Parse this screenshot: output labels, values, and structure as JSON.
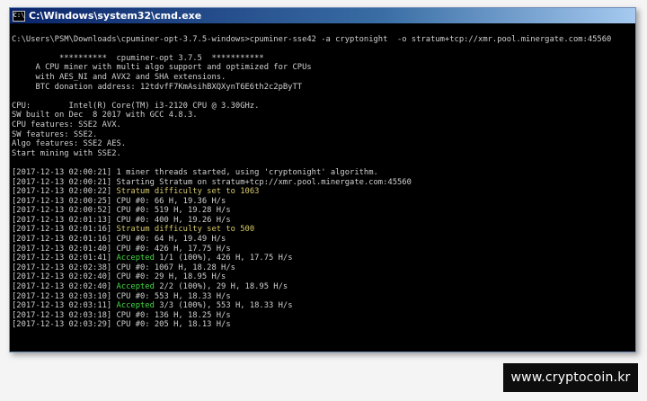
{
  "window": {
    "title": "C:\\Windows\\system32\\cmd.exe",
    "icon": "cmd-icon"
  },
  "console": {
    "lines": [
      {
        "text": ""
      },
      {
        "text": "C:\\Users\\PSM\\Downloads\\cpuminer-opt-3.7.5-windows>cpuminer-sse42 -a cryptonight  -o stratum+tcp://xmr.pool.minergate.com:45560"
      },
      {
        "text": ""
      },
      {
        "text": "          **********  cpuminer-opt 3.7.5  ***********"
      },
      {
        "text": "     A CPU miner with multi algo support and optimized for CPUs"
      },
      {
        "text": "     with AES_NI and AVX2 and SHA extensions."
      },
      {
        "text": "     BTC donation address: 12tdvfF7KmAsihBXQXynT6E6th2c2pByTT"
      },
      {
        "text": ""
      },
      {
        "text": "CPU:        Intel(R) Core(TM) i3-2120 CPU @ 3.30GHz."
      },
      {
        "text": "SW built on Dec  8 2017 with GCC 4.8.3."
      },
      {
        "text": "CPU features: SSE2 AVX."
      },
      {
        "text": "SW features: SSE2."
      },
      {
        "text": "Algo features: SSE2 AES."
      },
      {
        "text": "Start mining with SSE2."
      },
      {
        "text": ""
      },
      {
        "text": "[2017-12-13 02:00:21] 1 miner threads started, using 'cryptonight' algorithm."
      },
      {
        "text": "[2017-12-13 02:00:21] Starting Stratum on stratum+tcp://xmr.pool.minergate.com:45560"
      },
      {
        "prefix": "[2017-12-13 02:00:22] ",
        "highlight": "Stratum difficulty set to 1063",
        "style": "yellow",
        "suffix": ""
      },
      {
        "text": "[2017-12-13 02:00:25] CPU #0: 66 H, 19.36 H/s"
      },
      {
        "text": "[2017-12-13 02:00:52] CPU #0: 519 H, 19.28 H/s"
      },
      {
        "text": "[2017-12-13 02:01:13] CPU #0: 400 H, 19.26 H/s"
      },
      {
        "prefix": "[2017-12-13 02:01:16] ",
        "highlight": "Stratum difficulty set to 500",
        "style": "yellow",
        "suffix": ""
      },
      {
        "text": "[2017-12-13 02:01:16] CPU #0: 64 H, 19.49 H/s"
      },
      {
        "text": "[2017-12-13 02:01:40] CPU #0: 426 H, 17.75 H/s"
      },
      {
        "prefix": "[2017-12-13 02:01:41] ",
        "highlight": "Accepted",
        "style": "green",
        "suffix": " 1/1 (100%), 426 H, 17.75 H/s"
      },
      {
        "text": "[2017-12-13 02:02:38] CPU #0: 1067 H, 18.28 H/s"
      },
      {
        "text": "[2017-12-13 02:02:40] CPU #0: 29 H, 18.95 H/s"
      },
      {
        "prefix": "[2017-12-13 02:02:40] ",
        "highlight": "Accepted",
        "style": "green",
        "suffix": " 2/2 (100%), 29 H, 18.95 H/s"
      },
      {
        "text": "[2017-12-13 02:03:10] CPU #0: 553 H, 18.33 H/s"
      },
      {
        "prefix": "[2017-12-13 02:03:11] ",
        "highlight": "Accepted",
        "style": "green",
        "suffix": " 3/3 (100%), 553 H, 18.33 H/s"
      },
      {
        "text": "[2017-12-13 02:03:18] CPU #0: 136 H, 18.25 H/s"
      },
      {
        "text": "[2017-12-13 02:03:29] CPU #0: 205 H, 18.13 H/s"
      }
    ]
  },
  "watermark": {
    "text": "www.cryptocoin.kr"
  },
  "colors": {
    "difficulty": "#d6c96a",
    "accepted": "#46d946",
    "console_text": "#d0d0d0",
    "console_bg": "#000000"
  }
}
